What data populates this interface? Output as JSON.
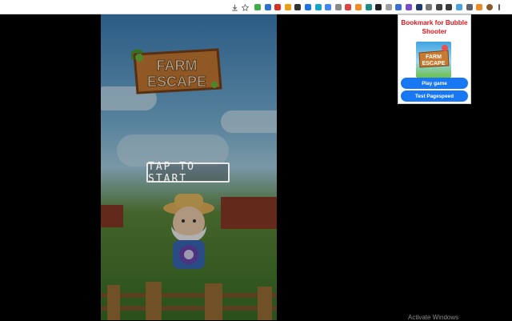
{
  "browser": {
    "toolbar_icons": [
      "download-icon",
      "star-icon"
    ],
    "extension_icons": [
      {
        "name": "ext-green-arrow-icon",
        "color": "#3fae49"
      },
      {
        "name": "ext-blue-box-icon",
        "color": "#2f6fd6"
      },
      {
        "name": "ext-red-mail-icon",
        "color": "#d93025"
      },
      {
        "name": "ext-orange-circle-icon",
        "color": "#e8a012"
      },
      {
        "name": "ext-dark-leaf-icon",
        "color": "#333333"
      },
      {
        "name": "ext-blue-search-icon",
        "color": "#1a73e8"
      },
      {
        "name": "ext-cyan-square-icon",
        "color": "#12a5c9"
      },
      {
        "name": "ext-blue-puzzle-icon",
        "color": "#4285f4"
      },
      {
        "name": "ext-gray-doc-icon",
        "color": "#8a8a8a"
      },
      {
        "name": "ext-red-flag-icon",
        "color": "#e04141"
      },
      {
        "name": "ext-orange-box-icon",
        "color": "#f28b21"
      },
      {
        "name": "ext-teal-square-icon",
        "color": "#1b8d83"
      },
      {
        "name": "ext-black-square-icon",
        "color": "#222222"
      },
      {
        "name": "ext-gray-card-icon",
        "color": "#9e9e9e"
      },
      {
        "name": "ext-blue-tag-icon",
        "color": "#3c6fd1"
      },
      {
        "name": "ext-purple-square-icon",
        "color": "#7a4bd0"
      },
      {
        "name": "ext-navy-square-icon",
        "color": "#1f3a6b"
      },
      {
        "name": "ext-gray-tag-icon",
        "color": "#777777"
      },
      {
        "name": "ext-dark-text-icon",
        "color": "#444444"
      },
      {
        "name": "ext-dark-square-icon",
        "color": "#3a3a3a"
      },
      {
        "name": "ext-bubble-shooter-icon",
        "color": "#4aa3df"
      },
      {
        "name": "puzzle-extensions-icon",
        "color": "#5f6368"
      },
      {
        "name": "ext-orange-dot-icon",
        "color": "#f08a24"
      },
      {
        "name": "profile-avatar-icon",
        "color": "#8b5a2b"
      },
      {
        "name": "kebab-menu-icon",
        "color": "#5f6368"
      }
    ]
  },
  "game": {
    "logo_line1": "FARM",
    "logo_line2": "ESCAPE",
    "tap_to_start": "TAP TO START"
  },
  "popup": {
    "title": "Bookmark for Bubble Shooter",
    "thumb_line1": "FARM",
    "thumb_line2": "ESCAPE",
    "play_label": "Play game",
    "test_label": "Test Pagespeed",
    "title_color": "#e0141e",
    "button_color": "#1877f2"
  },
  "watermark": "Activate Windows"
}
